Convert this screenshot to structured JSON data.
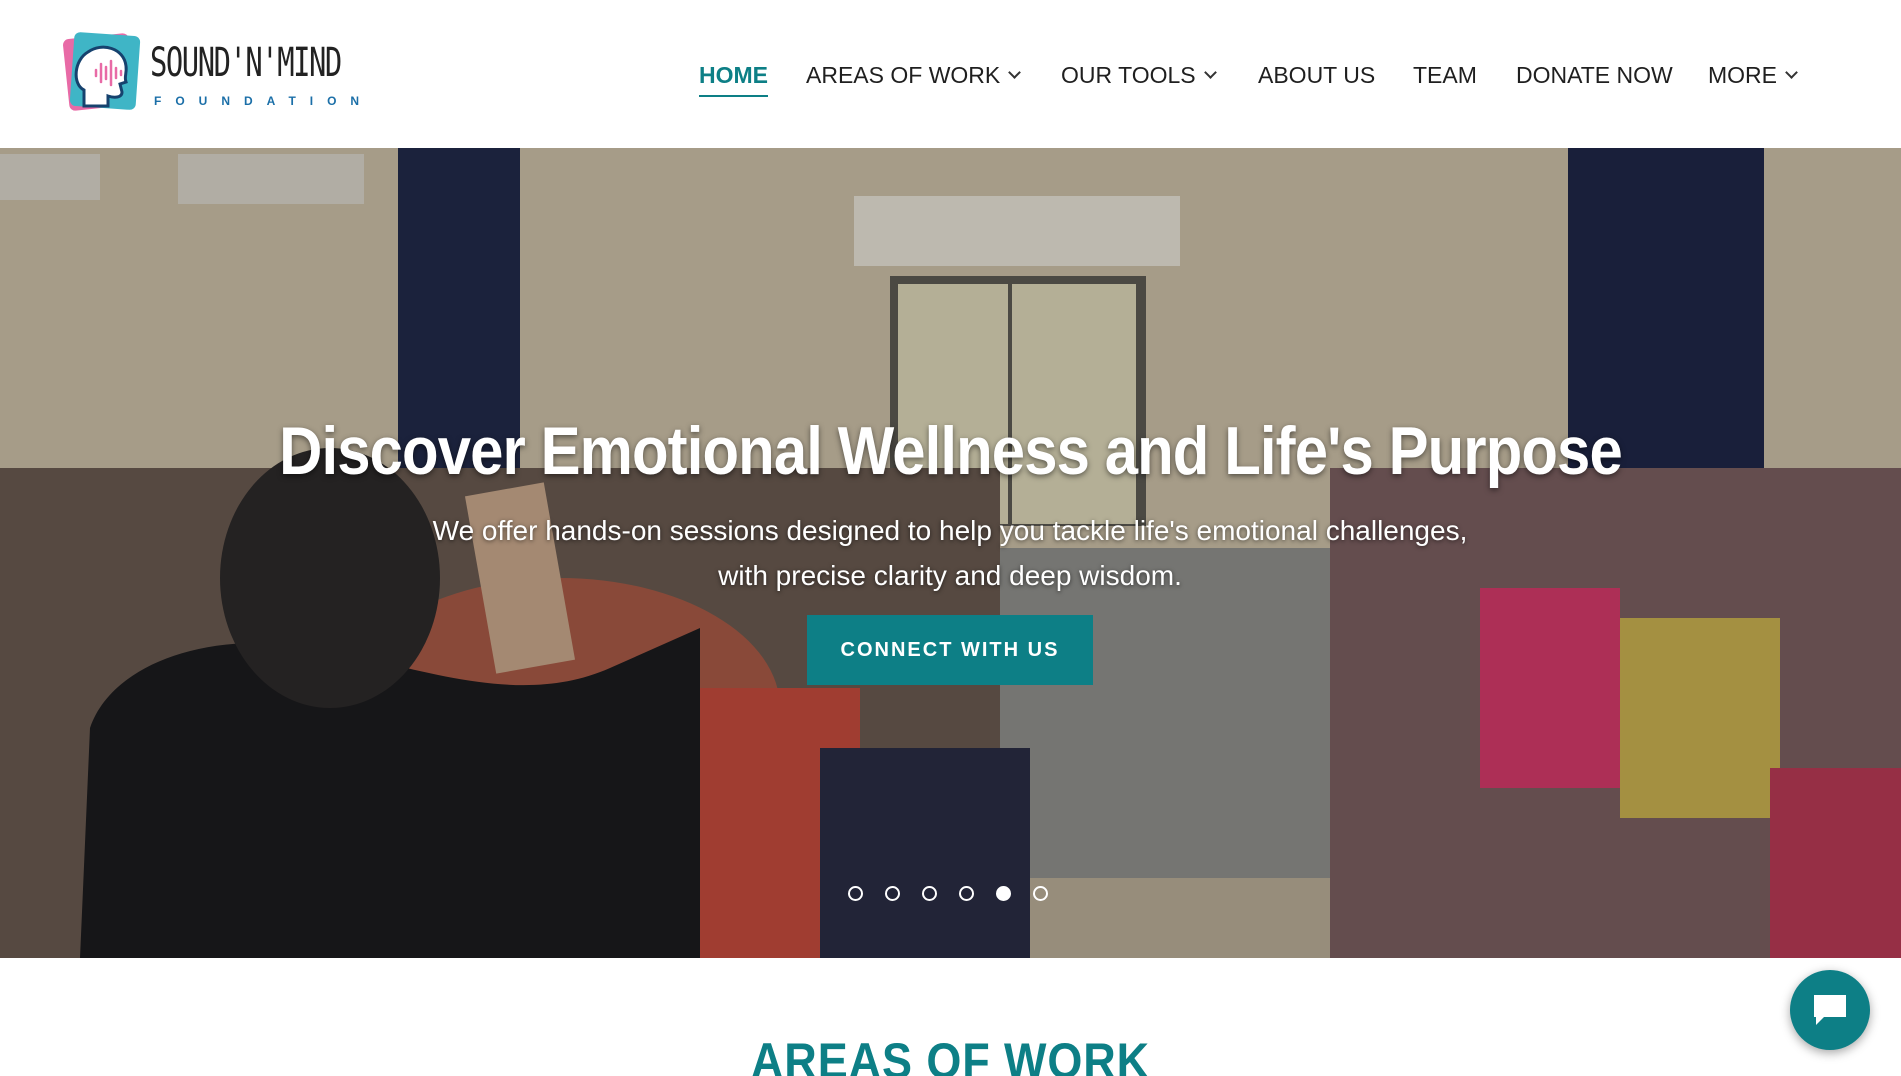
{
  "brand": {
    "name": "SOUND'N'MIND",
    "sub": "FOUNDATION",
    "colors": {
      "teal": "#0d7f86",
      "pink": "#e86aa6",
      "blue": "#1b6fa8"
    }
  },
  "nav": {
    "items": [
      {
        "label": "HOME",
        "active": true,
        "dropdown": false
      },
      {
        "label": "AREAS OF WORK",
        "active": false,
        "dropdown": true
      },
      {
        "label": "OUR TOOLS",
        "active": false,
        "dropdown": true
      },
      {
        "label": "ABOUT US",
        "active": false,
        "dropdown": false
      },
      {
        "label": "TEAM",
        "active": false,
        "dropdown": false
      },
      {
        "label": "DONATE NOW",
        "active": false,
        "dropdown": false
      },
      {
        "label": "MORE",
        "active": false,
        "dropdown": true
      }
    ]
  },
  "hero": {
    "title": "Discover Emotional Wellness and Life's Purpose",
    "subtitle_line1": "We offer hands-on sessions designed to help you tackle life's emotional challenges,",
    "subtitle_line2": "with precise clarity and deep wisdom.",
    "cta": "CONNECT WITH US",
    "slides": {
      "count": 6,
      "active_index": 4
    }
  },
  "section": {
    "title": "AREAS OF WORK"
  },
  "chat": {
    "icon": "chat-bubble-icon"
  },
  "accent_color": "#0d7f86"
}
